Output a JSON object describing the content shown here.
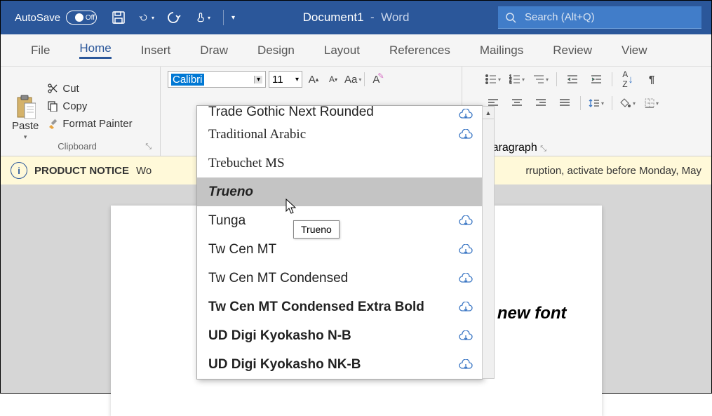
{
  "titlebar": {
    "autosave_label": "AutoSave",
    "autosave_state": "Off",
    "doc_name": "Document1",
    "app_name": "Word",
    "search_placeholder": "Search (Alt+Q)"
  },
  "tabs": [
    "File",
    "Home",
    "Insert",
    "Draw",
    "Design",
    "Layout",
    "References",
    "Mailings",
    "Review",
    "View"
  ],
  "active_tab": "Home",
  "clipboard": {
    "paste_label": "Paste",
    "cut_label": "Cut",
    "copy_label": "Copy",
    "fp_label": "Format Painter",
    "group_label": "Clipboard"
  },
  "font_group": {
    "font_name": "Calibri",
    "font_size": "11"
  },
  "paragraph": {
    "group_label": "Paragraph"
  },
  "notice": {
    "title": "PRODUCT NOTICE",
    "msg_left": "Wo",
    "msg_right": "rruption, activate before Monday, May"
  },
  "document_text": "›f my new font",
  "font_dropdown": {
    "items": [
      {
        "label": "Trade Gothic Next Rounded",
        "cloud": true,
        "style": ""
      },
      {
        "label": "Traditional Arabic",
        "cloud": true,
        "style": "font-family:serif"
      },
      {
        "label": "Trebuchet MS",
        "cloud": false,
        "style": "font-family:'Trebuchet MS'"
      },
      {
        "label": "Trueno",
        "cloud": false,
        "style": "font-weight:900;font-style:italic"
      },
      {
        "label": "Tunga",
        "cloud": true,
        "style": ""
      },
      {
        "label": "Tw Cen MT",
        "cloud": true,
        "style": ""
      },
      {
        "label": "Tw Cen MT Condensed",
        "cloud": true,
        "style": "font-stretch:condensed"
      },
      {
        "label": "Tw Cen MT Condensed Extra Bold",
        "cloud": true,
        "style": "font-weight:900"
      },
      {
        "label": "UD Digi Kyokasho N-B",
        "cloud": true,
        "style": "font-weight:600"
      },
      {
        "label": "UD Digi Kyokasho NK-B",
        "cloud": true,
        "style": "font-weight:600"
      }
    ],
    "hover_index": 3,
    "tooltip_text": "Trueno"
  }
}
